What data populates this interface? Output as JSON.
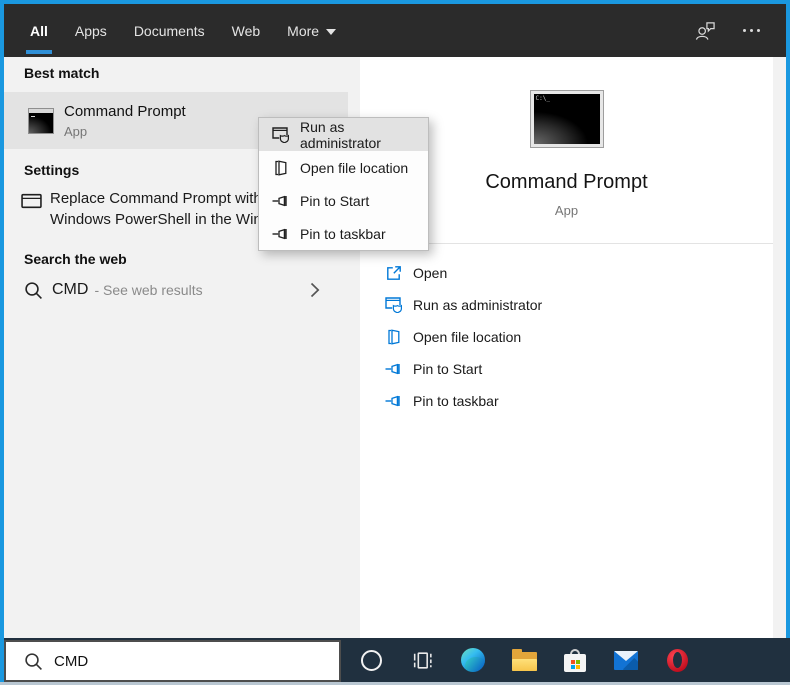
{
  "colors": {
    "accent_blue": "#0078d7",
    "window_border": "#1a98e0",
    "topbar_bg": "#2b2b2b",
    "left_panel_bg": "#f2f2f2",
    "highlight_row": "#e3e3e3",
    "taskbar_bg": "#20303f"
  },
  "topbar": {
    "tabs": [
      "All",
      "Apps",
      "Documents",
      "Web",
      "More"
    ],
    "active_tab": "All",
    "right_icons": [
      "feedback-icon",
      "ellipsis-icon"
    ]
  },
  "left_panel": {
    "best_match": {
      "header": "Best match",
      "item": {
        "title": "Command Prompt",
        "subtitle": "App",
        "icon": "command-prompt-icon"
      }
    },
    "settings": {
      "header": "Settings",
      "item": {
        "line1": "Replace Command Prompt with",
        "line2": "Windows PowerShell in the Win",
        "icon": "window-icon"
      }
    },
    "search_web": {
      "header": "Search the web",
      "item": {
        "query": "CMD",
        "hint": "- See web results",
        "icon": "search-icon",
        "chevron": "chevron-right-icon"
      }
    }
  },
  "context_menu": {
    "items": [
      {
        "label": "Run as administrator",
        "icon": "run-as-administrator-icon",
        "highlighted": true
      },
      {
        "label": "Open file location",
        "icon": "open-file-location-icon",
        "highlighted": false
      },
      {
        "label": "Pin to Start",
        "icon": "pin-icon",
        "highlighted": false
      },
      {
        "label": "Pin to taskbar",
        "icon": "pin-icon",
        "highlighted": false
      }
    ]
  },
  "preview": {
    "title": "Command Prompt",
    "subtitle": "App",
    "app_icon": "command-prompt-icon",
    "actions": [
      {
        "label": "Open",
        "icon": "open-icon"
      },
      {
        "label": "Run as administrator",
        "icon": "run-as-administrator-icon"
      },
      {
        "label": "Open file location",
        "icon": "open-file-location-icon"
      },
      {
        "label": "Pin to Start",
        "icon": "pin-icon"
      },
      {
        "label": "Pin to taskbar",
        "icon": "pin-icon"
      }
    ]
  },
  "search_box": {
    "value": "CMD",
    "icon": "search-icon"
  },
  "taskbar": {
    "buttons": [
      "cortana",
      "task-view",
      "edge",
      "file-explorer",
      "microsoft-store",
      "mail",
      "opera"
    ]
  }
}
